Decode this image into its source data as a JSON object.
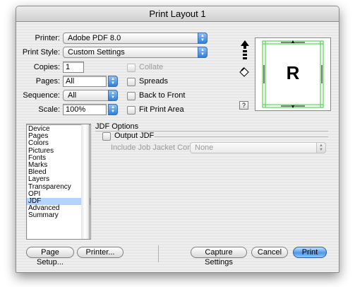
{
  "window": {
    "title": "Print Layout 1"
  },
  "printer": {
    "label": "Printer:",
    "value": "Adobe PDF 8.0"
  },
  "print_style": {
    "label": "Print Style:",
    "value": "Custom Settings"
  },
  "copies": {
    "label": "Copies:",
    "value": "1"
  },
  "pages": {
    "label": "Pages:",
    "value": "All"
  },
  "sequence": {
    "label": "Sequence:",
    "value": "All"
  },
  "scale": {
    "label": "Scale:",
    "value": "100%"
  },
  "checks": {
    "collate": "Collate",
    "spreads": "Spreads",
    "back_to_front": "Back to Front",
    "fit_print_area": "Fit Print Area"
  },
  "preview": {
    "letter": "R",
    "help": "?"
  },
  "panels": [
    "Device",
    "Pages",
    "Colors",
    "Pictures",
    "Fonts",
    "Marks",
    "Bleed",
    "Layers",
    "Transparency",
    "OPI",
    "JDF",
    "Advanced",
    "Summary"
  ],
  "selected_panel": "JDF",
  "jdf": {
    "heading": "JDF Options",
    "output_jdf": "Output JDF",
    "include_label": "Include Job Jacket Contact:",
    "include_value": "None"
  },
  "buttons": {
    "page_setup": "Page Setup...",
    "printer": "Printer...",
    "capture_settings": "Capture Settings",
    "cancel": "Cancel",
    "print": "Print"
  },
  "colors": {
    "accent": "#3d8ae6",
    "selection": "#b5d3ff"
  },
  "icons": [
    "chevron-updown-icon",
    "portrait-arrow-icon",
    "rotate-icon",
    "help-icon"
  ]
}
